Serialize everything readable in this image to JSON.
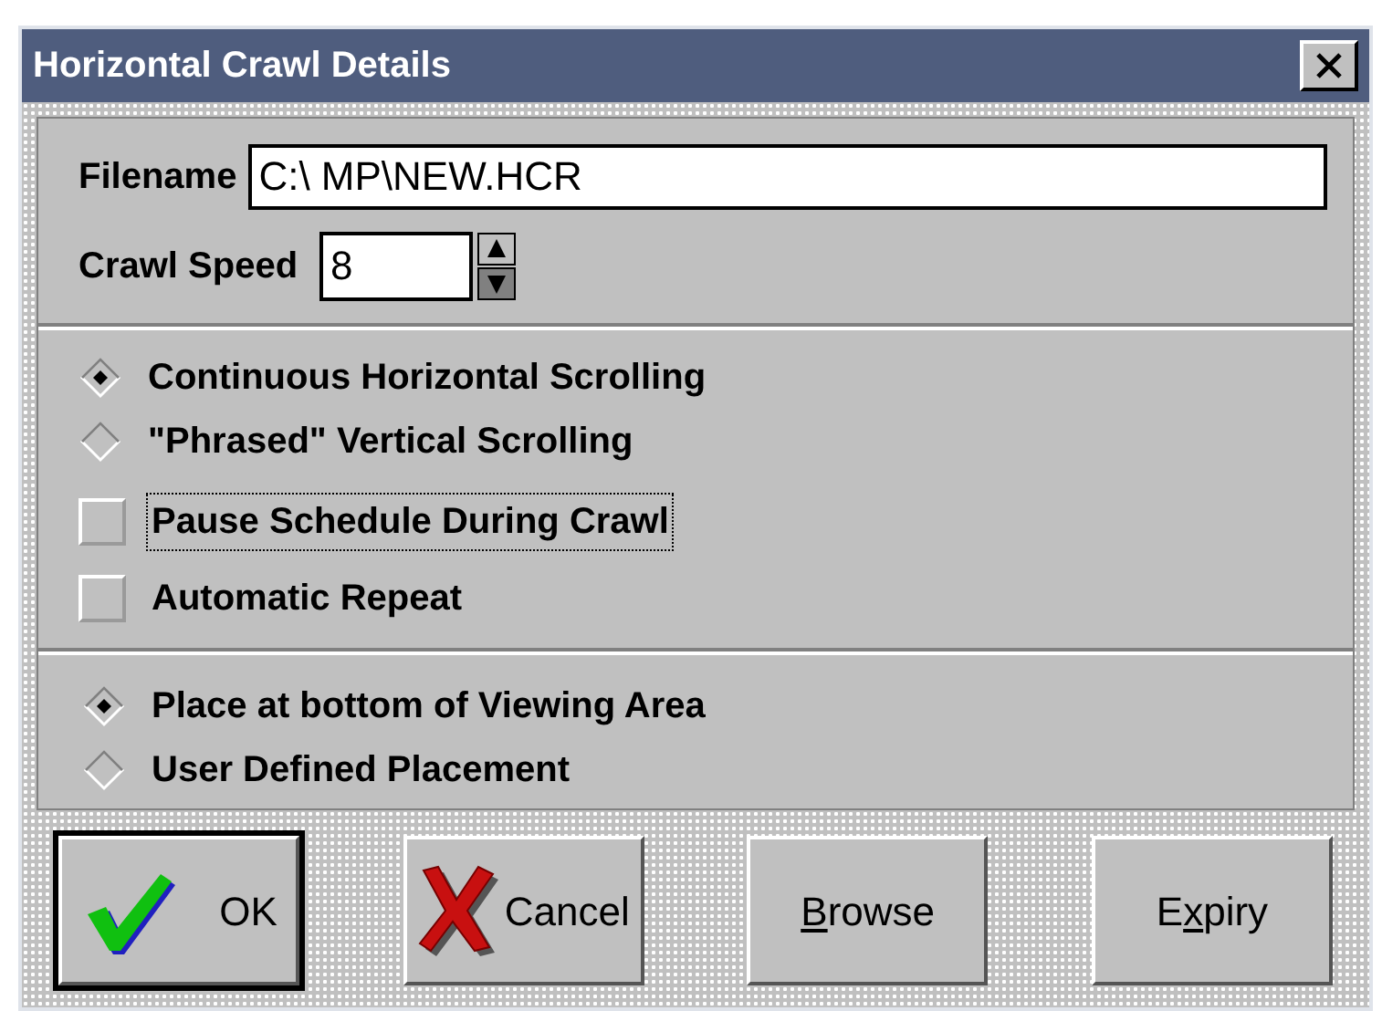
{
  "window": {
    "title": "Horizontal Crawl Details"
  },
  "filename": {
    "label": "Filename",
    "value": "C:\\ MP\\NEW.HCR"
  },
  "crawl_speed": {
    "label": "Crawl Speed",
    "value": "8"
  },
  "scroll_mode": [
    {
      "label": "Continuous Horizontal Scrolling",
      "selected": true
    },
    {
      "label": "\"Phrased\" Vertical Scrolling",
      "selected": false
    }
  ],
  "options": [
    {
      "label": "Pause Schedule During Crawl",
      "checked": false,
      "focused": true
    },
    {
      "label": "Automatic Repeat",
      "checked": false,
      "focused": false
    }
  ],
  "placement": [
    {
      "label": "Place at bottom of Viewing Area",
      "selected": true
    },
    {
      "label": "User Defined Placement",
      "selected": false
    }
  ],
  "buttons": [
    {
      "kind": "ok",
      "before": "OK",
      "default": true
    },
    {
      "kind": "cancel",
      "before": "Cancel",
      "default": false
    },
    {
      "kind": "plain",
      "key": "B",
      "after": "rowse",
      "default": false
    },
    {
      "kind": "plain",
      "before": "E",
      "key": "x",
      "after": "piry",
      "default": false
    }
  ]
}
